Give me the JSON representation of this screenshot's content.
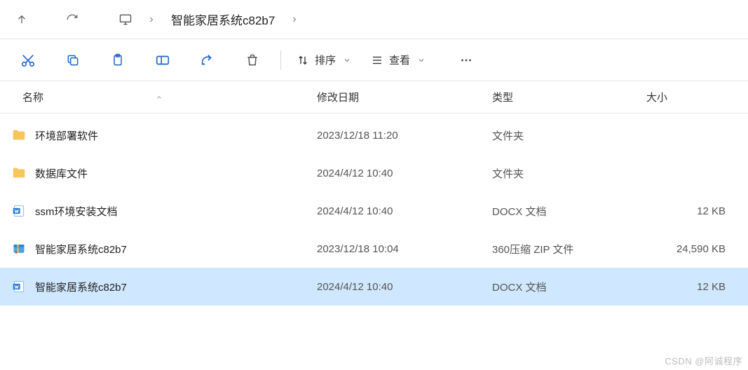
{
  "breadcrumb": {
    "current": "智能家居系统c82b7"
  },
  "toolbar": {
    "sort_label": "排序",
    "view_label": "查看"
  },
  "headers": {
    "name": "名称",
    "modified": "修改日期",
    "type": "类型",
    "size": "大小"
  },
  "files": [
    {
      "icon": "folder",
      "name": "环境部署软件",
      "modified": "2023/12/18 11:20",
      "type": "文件夹",
      "size": ""
    },
    {
      "icon": "folder",
      "name": "数据库文件",
      "modified": "2024/4/12 10:40",
      "type": "文件夹",
      "size": ""
    },
    {
      "icon": "docx",
      "name": "ssm环境安装文档",
      "modified": "2024/4/12 10:40",
      "type": "DOCX 文档",
      "size": "12 KB"
    },
    {
      "icon": "zip",
      "name": "智能家居系统c82b7",
      "modified": "2023/12/18 10:04",
      "type": "360压缩 ZIP 文件",
      "size": "24,590 KB"
    },
    {
      "icon": "docx",
      "name": "智能家居系统c82b7",
      "modified": "2024/4/12 10:40",
      "type": "DOCX 文档",
      "size": "12 KB",
      "selected": true
    }
  ],
  "watermark": "CSDN @阿诚程序"
}
